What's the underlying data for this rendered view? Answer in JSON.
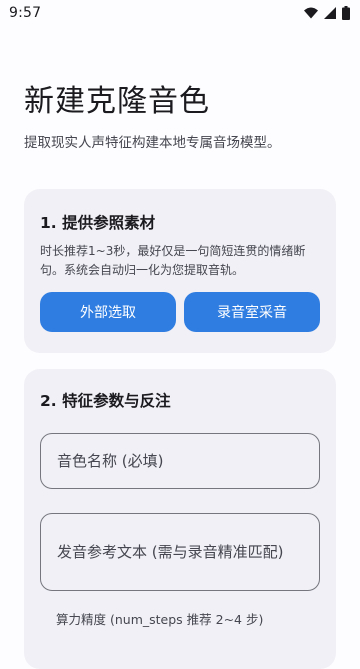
{
  "status_bar": {
    "time": "9:57",
    "icons": [
      "wifi-icon",
      "cellular-signal-icon",
      "battery-icon"
    ]
  },
  "page": {
    "title": "新建克隆音色",
    "subtitle": "提取现实人声特征构建本地专属音场模型。"
  },
  "section_source": {
    "title": "1. 提供参照素材",
    "description": "时长推荐1~3秒，最好仅是一句简短连贯的情绪断句。系统会自动归一化为您提取音轨。",
    "external_button": "外部选取",
    "record_button": "录音室采音"
  },
  "section_params": {
    "title": "2. 特征参数与反注",
    "name_placeholder": "音色名称 (必填)",
    "ref_text_placeholder": "发音参考文本 (需与录音精准匹配)",
    "steps_hint": "算力精度 (num_steps 推荐 2~4 步)"
  },
  "colors": {
    "accent": "#2f7de1",
    "card_background": "#f0f0f6",
    "page_background": "#fdfdff"
  }
}
